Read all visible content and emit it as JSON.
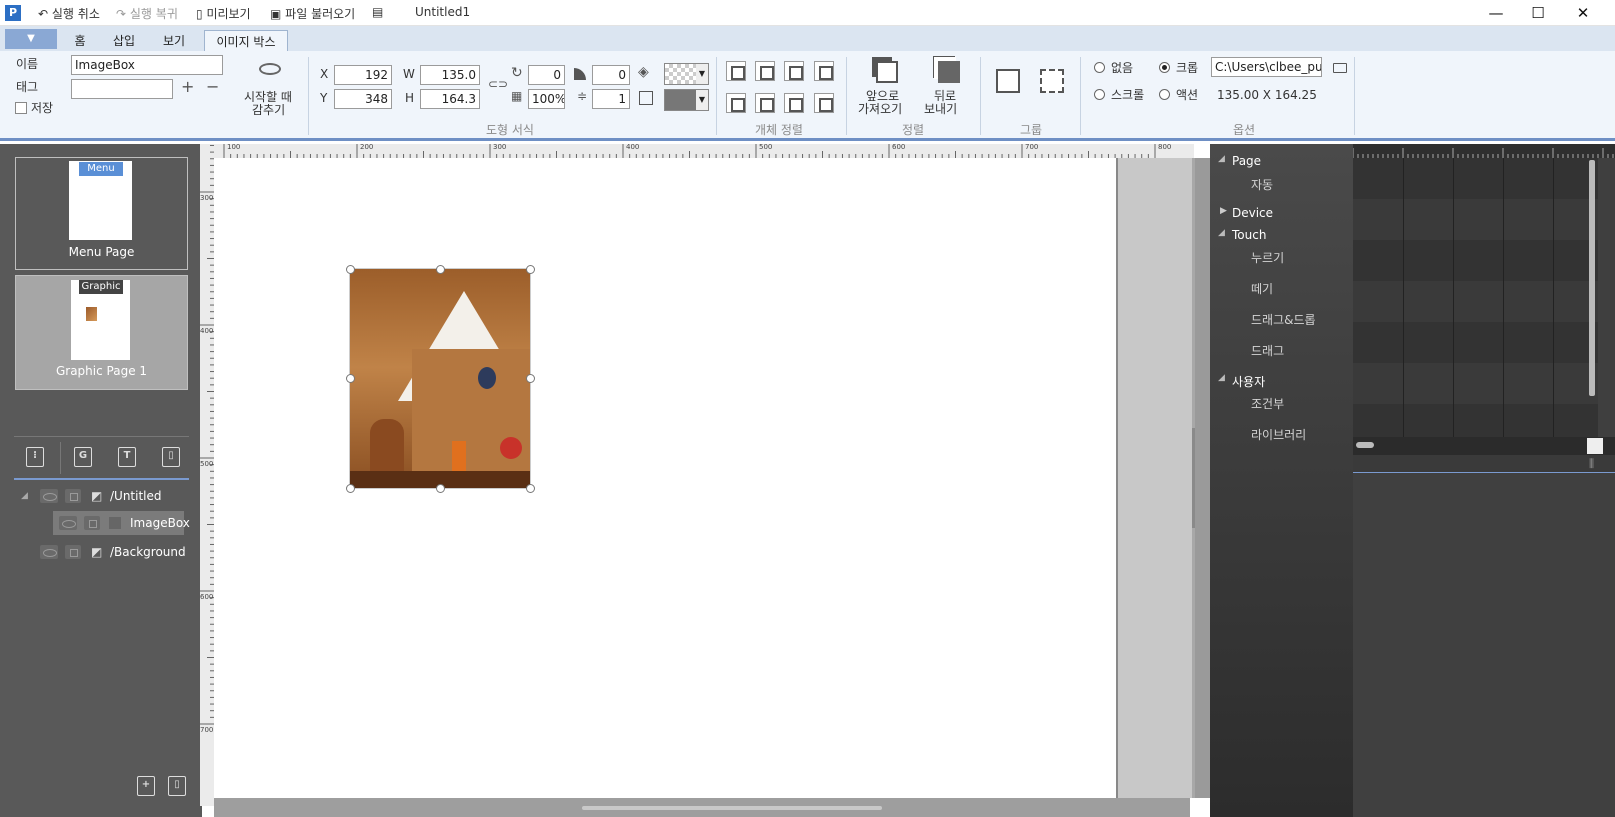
{
  "titlebar": {
    "undo": "실행 취소",
    "redo": "실행 복귀",
    "preview": "미리보기",
    "load_file": "파일 불러오기",
    "doc_title": "Untitled1"
  },
  "tabs": {
    "home": "홈",
    "insert": "삽입",
    "view": "보기",
    "image_box": "이미지 박스"
  },
  "ribbon": {
    "name_label": "이름",
    "name_value": "ImageBox",
    "tag_label": "태그",
    "tag_value": "",
    "save_label": "저장",
    "hide_label_1": "시작할 때",
    "hide_label_2": "감추기",
    "x_label": "X",
    "x_value": "192",
    "y_label": "Y",
    "y_value": "348",
    "w_label": "W",
    "w_value": "135.0",
    "h_label": "H",
    "h_value": "164.3",
    "rotation": "0",
    "corner": "0",
    "opacity": "100%",
    "line_width": "1",
    "shape_format": "도형 서식",
    "object_align": "개체 정렬",
    "bring_front_1": "앞으로",
    "bring_front_2": "가져오기",
    "send_back_1": "뒤로",
    "send_back_2": "보내기",
    "arrange": "정렬",
    "group": "그룹",
    "opt_none": "없음",
    "opt_crop": "크롭",
    "opt_scroll": "스크롤",
    "opt_action": "액션",
    "path_value": "C:\\Users\\clbee_pu",
    "size_text": "135.00 X 164.25",
    "options": "옵션"
  },
  "left": {
    "menu_badge": "Menu",
    "menu_caption": "Menu Page",
    "graphic_badge": "Graphic",
    "graphic_caption": "Graphic Page 1",
    "layer_untitled": "/Untitled",
    "layer_imagebox": "ImageBox",
    "layer_background": "/Background"
  },
  "ruler": {
    "top": [
      "100",
      "200",
      "300",
      "400",
      "500",
      "600",
      "700",
      "800"
    ],
    "left": [
      "300",
      "400",
      "500",
      "600",
      "700"
    ]
  },
  "events": {
    "page": "Page",
    "auto": "자동",
    "device": "Device",
    "touch": "Touch",
    "press": "누르기",
    "release": "떼기",
    "dragdrop": "드래그&드롭",
    "drag": "드래그",
    "user": "사용자",
    "conditional": "조건부",
    "library": "라이브러리"
  }
}
